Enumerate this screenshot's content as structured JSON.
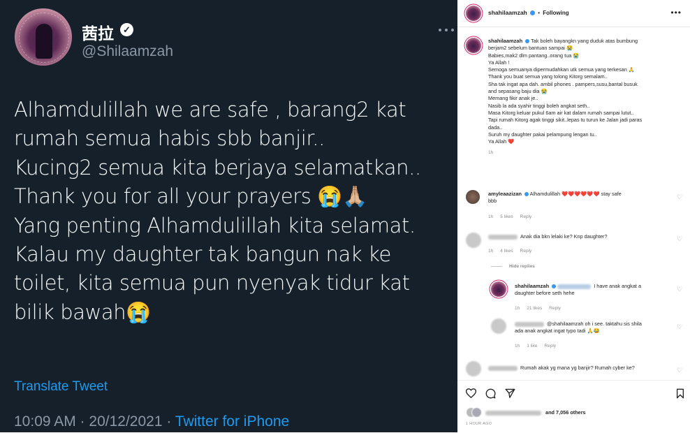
{
  "tweet": {
    "display_name": "茜拉",
    "handle": "@Shilaamzah",
    "lines": [
      "Alhamdulillah we are safe , barang2 kat",
      "rumah semua habis sbb banjir..",
      "Kucing2 semua kita berjaya selamatkan..",
      "Thank you for all your prayers 😭🙏🏼",
      "Yang penting Alhamdulillah kita selamat.",
      "Kalau my daughter tak bangun nak ke",
      "toilet, kita semua pun nyenyak tidur kat",
      "bilik bawah😭"
    ],
    "translate": "Translate Tweet",
    "time": "10:09 AM · 20/12/2021 · ",
    "source": "Twitter for iPhone"
  },
  "instagram": {
    "header": {
      "username": "shahilaamzah",
      "sep": "•",
      "follow": "Following"
    },
    "caption": {
      "username": "shahilaamzah",
      "lines": [
        "Tak boleh bayangkn yang duduk atas bumbung",
        "berjam2 sebelum bantuan sampai 😭",
        "Babies,mak2 dlm pantang..orang tua 😭",
        "Ya Allah !",
        "Semoga semuanya dipermudahkan utk semua yang terkesan 🙏",
        "Thank you buat semua yang tolong Kitorg semalam..",
        "Sha tak ingat apa dah. ambil phones . pampers,susu,bantal busuk",
        "and sepasang baju dia 😭",
        "Memang fikir anak je..",
        "Nasib la ada syahir tinggi boleh angkat seth..",
        "Masa Kitorg keluar pukul 6am air kat dalam rumah sampai lutut..",
        "Tapi rumah Kitorg agak tinggi sikit..lepas tu turun ke Jalan jadi paras",
        "dada..",
        "Suruh my daughter pakai pelampung lengan tu..",
        "Ya Allah ❤️"
      ],
      "time": "1h"
    },
    "comments": [
      {
        "user": "amyleaazizan",
        "text": "Alhamdulillah ❤️❤️❤️❤️❤️❤️ stay safe",
        "text2": "bbb",
        "time": "1h",
        "likes": "5 likes",
        "reply": "Reply"
      },
      {
        "user": "",
        "text": "Anak dia bkn lelaki ke? Knp daughter?",
        "time": "1h",
        "likes": "4 likes",
        "reply": "Reply"
      },
      {
        "hide_replies": "Hide replies"
      },
      {
        "user": "shahilaamzah",
        "text": "I have anak angkat a",
        "text2": "daughter before seth hehe",
        "time": "1h",
        "likes": "21 likes",
        "reply": "Reply"
      },
      {
        "user": "",
        "text": "@shahilaamzah oh i see. taktahu sis shila",
        "text2": "ada anak angkat ingat typo tadi 🙏😂",
        "time": "1h",
        "likes": "1 like",
        "reply": "Reply"
      },
      {
        "user": "",
        "text": "Rumah akak yg mana yg banjir? Rumah cyber ke?"
      }
    ],
    "likes_text": "and 7,056 others",
    "post_time": "1 HOUR AGO",
    "icons": [
      "heart-icon",
      "comment-icon",
      "share-icon",
      "bookmark-icon"
    ]
  }
}
